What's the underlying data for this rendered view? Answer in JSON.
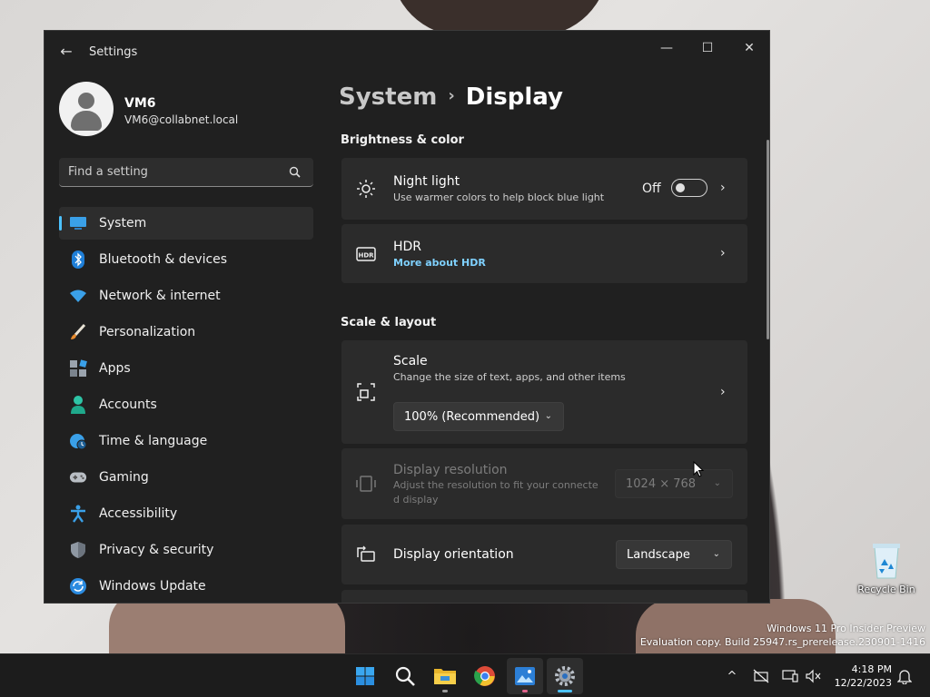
{
  "window": {
    "title": "Settings",
    "back_glyph": "←",
    "minimize_glyph": "—",
    "maximize_glyph": "☐",
    "close_glyph": "✕"
  },
  "user": {
    "name": "VM6",
    "email": "VM6@collabnet.local"
  },
  "search": {
    "placeholder": "Find a setting"
  },
  "sidebar": {
    "items": [
      {
        "label": "System",
        "icon": "system-icon",
        "active": true
      },
      {
        "label": "Bluetooth & devices",
        "icon": "bluetooth-icon"
      },
      {
        "label": "Network & internet",
        "icon": "wifi-icon"
      },
      {
        "label": "Personalization",
        "icon": "brush-icon"
      },
      {
        "label": "Apps",
        "icon": "apps-icon"
      },
      {
        "label": "Accounts",
        "icon": "person-icon"
      },
      {
        "label": "Time & language",
        "icon": "globe-clock-icon"
      },
      {
        "label": "Gaming",
        "icon": "gamepad-icon"
      },
      {
        "label": "Accessibility",
        "icon": "accessibility-icon"
      },
      {
        "label": "Privacy & security",
        "icon": "shield-icon"
      },
      {
        "label": "Windows Update",
        "icon": "update-icon"
      }
    ]
  },
  "header": {
    "parent": "System",
    "separator": "›",
    "current": "Display"
  },
  "sections": {
    "brightness": "Brightness & color",
    "scale": "Scale & layout"
  },
  "cards": {
    "night_light": {
      "title": "Night light",
      "subtitle": "Use warmer colors to help block blue light",
      "toggle_text": "Off",
      "toggle_on": false
    },
    "hdr": {
      "title": "HDR",
      "link": "More about HDR"
    },
    "scale": {
      "title": "Scale",
      "subtitle": "Change the size of text, apps, and other items",
      "value": "100% (Recommended)"
    },
    "resolution": {
      "title": "Display resolution",
      "subtitle_line1": "Adjust the resolution to fit your connecte",
      "subtitle_line2": "d display",
      "value": "1024 × 768"
    },
    "orientation": {
      "title": "Display orientation",
      "value": "Landscape"
    }
  },
  "chevron_glyph": "›",
  "dropdown_glyph": "⌄",
  "desktop": {
    "recycle_bin": "Recycle Bin",
    "watermark_line1": "Windows 11 Pro Insider Preview",
    "watermark_line2": "Evaluation copy. Build 25947.rs_prerelease.230901-1416"
  },
  "taskbar": {
    "apps": [
      "start-icon",
      "search-icon",
      "file-explorer-icon",
      "chrome-icon",
      "photos-icon",
      "settings-icon"
    ],
    "tray_chevron": "^",
    "time": "4:18 PM",
    "date": "12/22/2023"
  },
  "colors": {
    "accent": "#4cc2ff",
    "window_bg": "#202020",
    "card_bg": "#2b2b2b",
    "link": "#7fd1ff"
  }
}
